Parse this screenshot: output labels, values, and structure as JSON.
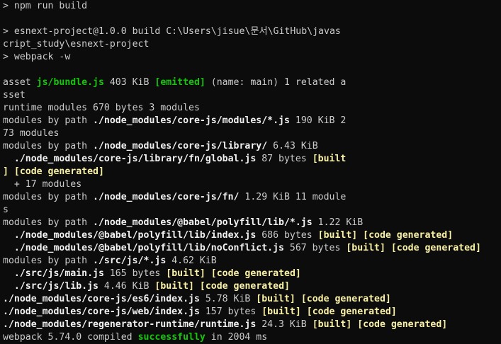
{
  "terminal": {
    "prompt_symbol": ">",
    "command": "npm run build",
    "script_line_1": "> esnext-project@1.0.0 build C:\\Users\\jisue\\문서\\GitHub\\javas",
    "script_line_2": "cript_study\\esnext-project",
    "script_line_3": "> webpack -w",
    "asset_prefix": "asset ",
    "asset_name": "js/bundle.js",
    "asset_size": " 403 KiB ",
    "asset_emitted": "[emitted]",
    "asset_rest": " (name: main) 1 related a",
    "asset_wrap": "sset",
    "runtime_line": "runtime modules 670 bytes 3 modules",
    "m1_prefix": "modules by path ",
    "m1_path": "./node_modules/core-js/modules/*.js",
    "m1_rest": " 190 KiB 2",
    "m1_wrap": "73 modules",
    "m2_prefix": "modules by path ",
    "m2_path": "./node_modules/core-js/library/",
    "m2_rest": " 6.43 KiB",
    "m2a_path": "  ./node_modules/core-js/library/fn/global.js",
    "m2a_size": " 87 bytes ",
    "m2a_built": "[built",
    "m2a_wrap_built": "]",
    "m2a_codegen": "[code generated]",
    "m2_more": "  + 17 modules",
    "m3_prefix": "modules by path ",
    "m3_path": "./node_modules/core-js/fn/",
    "m3_rest": " 1.29 KiB 11 module",
    "m3_wrap": "s",
    "m4_prefix": "modules by path ",
    "m4_path": "./node_modules/@babel/polyfill/lib/*.js",
    "m4_rest": " 1.22 KiB",
    "m4a_path": "  ./node_modules/@babel/polyfill/lib/index.js",
    "m4a_size": " 686 bytes ",
    "m4b_path": "  ./node_modules/@babel/polyfill/lib/noConflict.js",
    "m4b_size": " 567 bytes ",
    "m5_prefix": "modules by path ",
    "m5_path": "./src/js/*.js",
    "m5_rest": " 4.62 KiB",
    "m5a_path": "  ./src/js/main.js",
    "m5a_size": " 165 bytes ",
    "m5b_path": "  ./src/js/lib.js",
    "m5b_size": " 4.46 KiB ",
    "r1_path": "./node_modules/core-js/es6/index.js",
    "r1_size": " 5.78 KiB ",
    "r2_path": "./node_modules/core-js/web/index.js",
    "r2_size": " 157 bytes ",
    "r3_path": "./node_modules/regenerator-runtime/runtime.js",
    "r3_size": " 24.3 KiB ",
    "built_tag": "[built]",
    "codegen_tag": "[code generated]",
    "space": " ",
    "final_prefix": "webpack 5.74.0 compiled ",
    "final_status": "successfully",
    "final_rest": " in 2004 ms"
  },
  "colors": {
    "background": "#0c0c0c",
    "text": "#cccccc",
    "bright": "#f2f2f2",
    "yellow": "#f9f1a5",
    "green": "#16c60c"
  }
}
